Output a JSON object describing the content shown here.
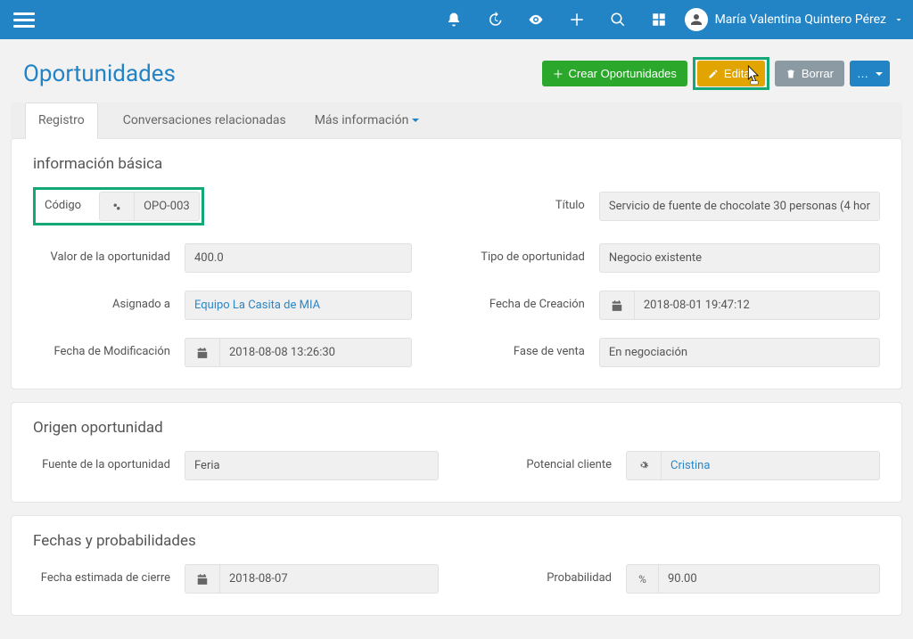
{
  "user": {
    "name": "María Valentina Quintero Pérez"
  },
  "page": {
    "title": "Oportunidades"
  },
  "actions": {
    "create": "Crear Oportunidades",
    "edit": "Editar",
    "delete": "Borrar"
  },
  "tabs": {
    "registro": "Registro",
    "conversaciones": "Conversaciones relacionadas",
    "mas": "Más información"
  },
  "section_basic": {
    "title": "información básica",
    "codigo": {
      "label": "Código",
      "value": "OPO-003"
    },
    "valor": {
      "label": "Valor de la oportunidad",
      "value": "400.0"
    },
    "asignado": {
      "label": "Asignado a",
      "value": "Equipo La Casita de MIA"
    },
    "fecha_mod": {
      "label": "Fecha de Modificación",
      "value": "2018-08-08 13:26:30"
    },
    "titulo": {
      "label": "Título",
      "value": "Servicio de fuente de chocolate 30 personas (4 hor"
    },
    "tipo": {
      "label": "Tipo de oportunidad",
      "value": "Negocio existente"
    },
    "fecha_crea": {
      "label": "Fecha de Creación",
      "value": "2018-08-01 19:47:12"
    },
    "fase": {
      "label": "Fase de venta",
      "value": "En negociación"
    }
  },
  "section_origen": {
    "title": "Origen oportunidad",
    "fuente": {
      "label": "Fuente de la oportunidad",
      "value": "Feria"
    },
    "potencial": {
      "label": "Potencial cliente",
      "value": "Cristina"
    }
  },
  "section_fechas": {
    "title": "Fechas y probabilidades",
    "fecha_cierre": {
      "label": "Fecha estimada de cierre",
      "value": "2018-08-07"
    },
    "probabilidad": {
      "label": "Probabilidad",
      "addon": "%",
      "value": "90.00"
    }
  }
}
